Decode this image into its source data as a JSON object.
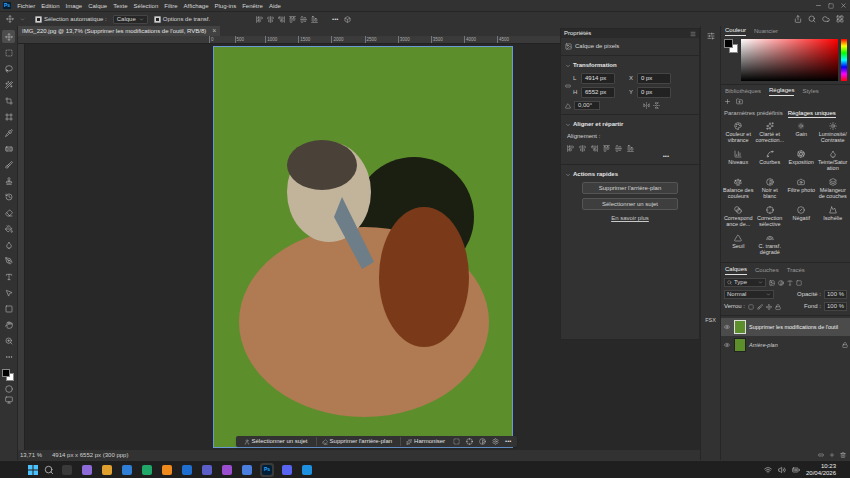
{
  "menubar": {
    "logo": "Ps",
    "items": [
      "Fichier",
      "Edition",
      "Image",
      "Calque",
      "Texte",
      "Sélection",
      "Filtre",
      "Affichage",
      "Plug-ins",
      "Fenêtre",
      "Aide"
    ]
  },
  "options_bar": {
    "auto_select": {
      "label": "Sélection automatique :",
      "checked": true
    },
    "target": "Calque",
    "transform": {
      "label": "Options de transf.",
      "checked": true
    },
    "more": "•••"
  },
  "toolbar": {
    "tools": [
      {
        "selected": true
      },
      {
        "selected": false
      },
      {
        "selected": false
      },
      {
        "selected": false
      },
      {
        "selected": false
      },
      {
        "selected": false
      },
      {
        "selected": false
      },
      {
        "selected": false
      },
      {
        "selected": false
      },
      {
        "selected": false
      },
      {
        "selected": false
      },
      {
        "selected": false
      },
      {
        "selected": false
      },
      {
        "selected": false
      },
      {
        "selected": false
      },
      {
        "selected": false
      },
      {
        "selected": false
      },
      {
        "selected": false
      },
      {
        "selected": false
      },
      {
        "selected": false
      },
      {
        "selected": false
      }
    ]
  },
  "document": {
    "tab": "IMG_220.jpg @ 13,7% (Supprimer les modifications de l'outil, RVB/8)",
    "close": "×",
    "ruler": [
      "0",
      "500",
      "1000",
      "1500",
      "2000",
      "2500",
      "3000",
      "3500",
      "4000",
      "4500"
    ]
  },
  "context_bar": {
    "actions": [
      "Sélectionner un sujet",
      "Supprimer l'arrière-plan",
      "Harmoniser"
    ],
    "more": "•••"
  },
  "status_bar": {
    "zoom": "13,71 %",
    "size": "4914 px x 6552 px (300 ppp)"
  },
  "properties": {
    "title": "Propriétés",
    "layer_type": "Calque de pixels",
    "transform": {
      "title": "Transformation",
      "width_label": "L",
      "width": "4914 px",
      "height_label": "H",
      "height": "6552 px",
      "x_label": "X",
      "x": "0 px",
      "y_label": "Y",
      "y": "0 px",
      "angle": "0,00°"
    },
    "align": {
      "title": "Aligner et répartir",
      "label": "Alignement :",
      "more": "•••"
    },
    "quick_actions": {
      "title": "Actions rapides",
      "buttons": [
        "Supprimer l'arrière-plan",
        "Sélectionner un sujet"
      ],
      "link": "En savoir plus"
    }
  },
  "color_panel": {
    "tabs": [
      {
        "label": "Couleur",
        "selected": true
      },
      {
        "label": "Nuancier",
        "selected": false
      }
    ]
  },
  "adjustments": {
    "tabs": [
      {
        "label": "Bibliothèques",
        "selected": false
      },
      {
        "label": "Réglages",
        "selected": true
      },
      {
        "label": "Styles",
        "selected": false
      }
    ],
    "subtabs": [
      {
        "label": "Paramètres prédéfinis",
        "selected": false
      },
      {
        "label": "Réglages uniques",
        "selected": true
      }
    ],
    "items": [
      "Couleur et vibrance",
      "Clarté et correction...",
      "Gain",
      "Luminosité/Contraste",
      "Niveaux",
      "Courbes",
      "Exposition",
      "Teinte/Saturation",
      "Balance des couleurs",
      "Noir et blanc",
      "Filtre photo",
      "Mélangeur de couches",
      "Correspondance de...",
      "Correction sélective",
      "Négatif",
      "Isohélie",
      "Seuil",
      "C. transf. dégradé"
    ]
  },
  "side_strip": {
    "label": "FSX"
  },
  "layers": {
    "tabs": [
      {
        "label": "Calques",
        "selected": true
      },
      {
        "label": "Couches",
        "selected": false
      },
      {
        "label": "Tracés",
        "selected": false
      }
    ],
    "filter": "Type",
    "blend_mode": "Normal",
    "opacity_label": "Opacité :",
    "opacity": "100 %",
    "lock_label": "Verrou :",
    "fill_label": "Fond :",
    "fill": "100 %",
    "items": [
      {
        "name": "Supprimer les modifications de l'outil",
        "visible": true,
        "selected": true,
        "locked": false
      },
      {
        "name": "Arrière-plan",
        "visible": true,
        "selected": false,
        "locked": true
      }
    ]
  },
  "taskbar": {
    "apps": [
      {
        "color": "#3a3a3a",
        "label": "",
        "active": false
      },
      {
        "color": "#8e6bd8",
        "label": "",
        "active": false
      },
      {
        "color": "#e0a030",
        "label": "",
        "active": false
      },
      {
        "color": "#2f7fd6",
        "label": "",
        "active": false
      },
      {
        "color": "#20a868",
        "label": "",
        "active": false
      },
      {
        "color": "#f08a1c",
        "label": "",
        "active": false
      },
      {
        "color": "#1f6fd0",
        "label": "",
        "active": false
      },
      {
        "color": "#5b5fc7",
        "label": "",
        "active": false
      },
      {
        "color": "#9b4fd0",
        "label": "",
        "active": false
      },
      {
        "color": "#4a7fe0",
        "label": "",
        "active": false
      },
      {
        "color": "#001e36",
        "label": "Ps",
        "active": true
      },
      {
        "color": "#5865f2",
        "label": "",
        "active": false
      },
      {
        "color": "#1e90e0",
        "label": "",
        "active": false
      }
    ],
    "time": "10:23",
    "date": "20/04/2026"
  }
}
